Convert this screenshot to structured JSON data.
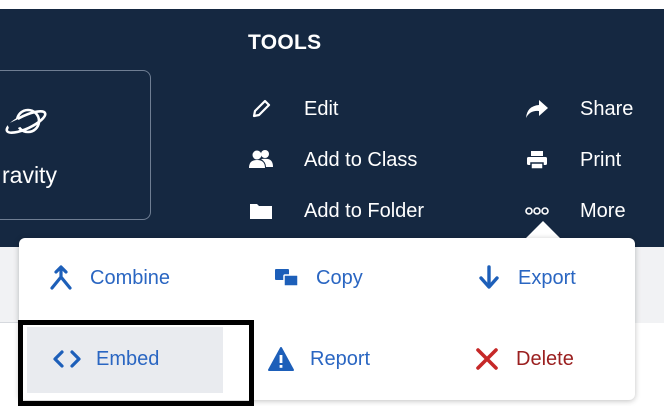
{
  "set_card": {
    "title": "ravity",
    "icon": "planet-icon"
  },
  "tools": {
    "heading": "TOOLS",
    "items": [
      {
        "label": "Edit",
        "icon": "pencil-icon"
      },
      {
        "label": "Add to Class",
        "icon": "users-icon"
      },
      {
        "label": "Add to Folder",
        "icon": "folder-icon"
      },
      {
        "label": "Share",
        "icon": "share-arrow-icon"
      },
      {
        "label": "Print",
        "icon": "printer-icon"
      },
      {
        "label": "More",
        "icon": "more-dots-icon"
      }
    ]
  },
  "more_menu": {
    "items": [
      {
        "label": "Combine",
        "icon": "combine-icon"
      },
      {
        "label": "Copy",
        "icon": "copy-icon"
      },
      {
        "label": "Export",
        "icon": "export-arrow-icon"
      },
      {
        "label": "Embed",
        "icon": "embed-code-icon"
      },
      {
        "label": "Report",
        "icon": "warning-icon"
      },
      {
        "label": "Delete",
        "icon": "x-icon"
      }
    ]
  },
  "colors": {
    "header_bg": "#152841",
    "text_on_dark": "#ffffff",
    "menu_blue": "#1d5fb9",
    "menu_text_blue": "#2a66c2",
    "delete_red": "#c62828",
    "delete_text": "#9b2020",
    "highlight_bg": "#e9ebef",
    "selection_frame": "#000000"
  }
}
